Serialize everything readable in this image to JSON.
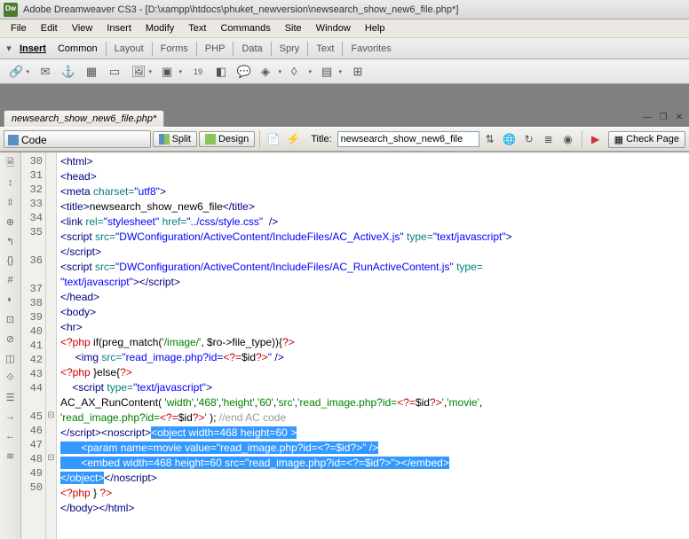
{
  "title": "Adobe Dreamweaver CS3 - [D:\\xampp\\htdocs\\phuket_newversion\\newsearch_show_new6_file.php*]",
  "menu": [
    "File",
    "Edit",
    "View",
    "Insert",
    "Modify",
    "Text",
    "Commands",
    "Site",
    "Window",
    "Help"
  ],
  "insert": {
    "label": "Insert",
    "tabs": [
      "Common",
      "Layout",
      "Forms",
      "PHP",
      "Data",
      "Spry",
      "Text",
      "Favorites"
    ]
  },
  "doc": {
    "tab": "newsearch_show_new6_file.php*",
    "views": {
      "code": "Code",
      "split": "Split",
      "design": "Design"
    },
    "title_label": "Title:",
    "title_value": "newsearch_show_new6_file",
    "check_page": "Check Page"
  },
  "lines": {
    "start": 30,
    "end": 50
  },
  "code": {
    "l30": {
      "tag": "<html>"
    },
    "l31": {
      "tag": "<head>"
    },
    "l32": {
      "a": "<meta ",
      "b": "charset=",
      "c": "\"utf8\"",
      "d": ">"
    },
    "l33": {
      "a": "<title>",
      "b": "newsearch_show_new6_file",
      "c": "</title>"
    },
    "l34": {
      "a": "<link ",
      "b": "rel=",
      "c": "\"stylesheet\"",
      "d": " href=",
      "e": "\"../css/style.css\"",
      "f": "  />"
    },
    "l35": {
      "a": "<script ",
      "b": "src=",
      "c": "\"DWConfiguration/ActiveContent/IncludeFiles/AC_ActiveX.js\"",
      "d": " type=",
      "e": "\"text/javascript\"",
      "f": ">",
      "g": "</script>"
    },
    "l36": {
      "a": "<script ",
      "b": "src=",
      "c": "\"DWConfiguration/ActiveContent/IncludeFiles/AC_RunActiveContent.js\"",
      "d": " type=",
      "e": "\"text/javascript\"",
      "f": ">",
      "g": "</script>"
    },
    "l37": {
      "tag": "</head>"
    },
    "l38": {
      "tag": "<body>"
    },
    "l39": {
      "tag": "<hr>"
    },
    "l40": {
      "a": "<?php",
      "b": " if(preg_match(",
      "c": "'/image/'",
      "d": ", $ro->file_type)){",
      "e": "?>"
    },
    "l41": {
      "a": "     <img ",
      "b": "src=",
      "c": "\"read_image.php?id=",
      "d": "<?=",
      "e": "$id",
      "f": "?>",
      "g": "\"",
      "h": " />"
    },
    "l42": {
      "a": "<?php",
      "b": " }else{",
      "c": "?>"
    },
    "l43": {
      "a": "    <script ",
      "b": "type=",
      "c": "\"text/javascript\"",
      "d": ">"
    },
    "l44": {
      "a": "AC_AX_RunContent( ",
      "b": "'width'",
      "c": ",",
      "d": "'468'",
      "e": ",",
      "f": "'height'",
      "g": ",",
      "h": "'60'",
      "i": ",",
      "j": "'src'",
      "k": ",",
      "l": "'read_image.php?id=",
      "m": "<?=",
      "n": "$id",
      "o": "?>",
      "p": "'",
      "q": ",",
      "r": "'movie'",
      "s": ",",
      "t": "'read_image.php?id=",
      "u": "<?=",
      "v": "$id",
      "w": "?>",
      "x": "'",
      "y": " ); ",
      "z": "//end AC code"
    },
    "l45": {
      "a": "</script><noscript>",
      "b": "<object width=468 height=60 >"
    },
    "l46": {
      "a": "       <param name=movie value=\"read_image.php?id=",
      "b": "<?=$id?>",
      "c": "\" />"
    },
    "l47": {
      "a": "       <embed width=468 height=60 src=\"read_image.php?id=",
      "b": "<?=$id?>",
      "c": "\"></embed>"
    },
    "l48": {
      "a": "</object>",
      "b": "</noscript>"
    },
    "l49": {
      "a": "<?php",
      "b": " } ",
      "c": "?>"
    },
    "l50": {
      "a": "</body>",
      "b": "</html>"
    }
  }
}
